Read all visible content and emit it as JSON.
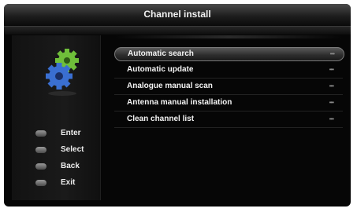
{
  "window": {
    "title": "Channel install"
  },
  "menu": {
    "items": [
      {
        "label": "Automatic search",
        "indicator": "•••",
        "selected": true
      },
      {
        "label": "Automatic update",
        "indicator": "•••",
        "selected": false
      },
      {
        "label": "Analogue manual scan",
        "indicator": "•••",
        "selected": false
      },
      {
        "label": "Antenna manual installation",
        "indicator": "•••",
        "selected": false
      },
      {
        "label": "Clean channel list",
        "indicator": "•••",
        "selected": false
      }
    ]
  },
  "legend": {
    "items": [
      {
        "label": "Enter",
        "icon": "ok-button-icon"
      },
      {
        "label": "Select",
        "icon": "arrow-button-icon"
      },
      {
        "label": "Back",
        "icon": "back-button-icon"
      },
      {
        "label": "Exit",
        "icon": "exit-button-icon"
      }
    ]
  },
  "colors": {
    "background": "#060606",
    "text": "#f4f4f4",
    "gear_green": "#6fbf3a",
    "gear_blue": "#3a6fd1"
  }
}
